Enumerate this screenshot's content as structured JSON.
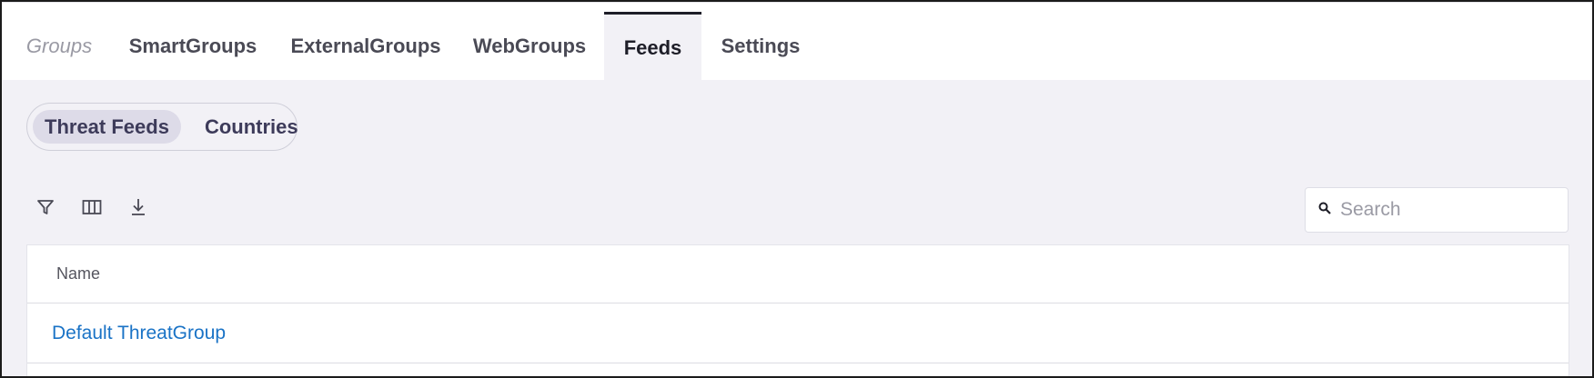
{
  "tabs": {
    "context_label": "Groups",
    "items": [
      {
        "label": "SmartGroups"
      },
      {
        "label": "ExternalGroups"
      },
      {
        "label": "WebGroups"
      },
      {
        "label": "Feeds",
        "active": true
      },
      {
        "label": "Settings"
      }
    ]
  },
  "segment": {
    "options": [
      {
        "label": "Threat Feeds",
        "selected": true
      },
      {
        "label": "Countries"
      }
    ]
  },
  "toolbar": {
    "icons": [
      "filter-icon",
      "columns-icon",
      "download-icon"
    ]
  },
  "search": {
    "placeholder": "Search",
    "value": ""
  },
  "table": {
    "columns": [
      "Name"
    ],
    "rows": [
      {
        "name": "Default ThreatGroup"
      }
    ]
  },
  "colors": {
    "background": "#f2f1f6",
    "link": "#1a73c6",
    "active_tab_border": "#1e1e28",
    "segment_selected": "#dddbe8"
  }
}
